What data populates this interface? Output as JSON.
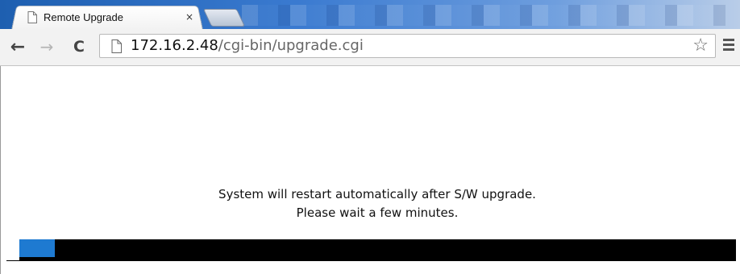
{
  "browser": {
    "tab": {
      "title": "Remote Upgrade",
      "close_label": "×"
    },
    "toolbar": {
      "back_icon": "back-arrow-icon",
      "forward_icon": "forward-arrow-icon",
      "reload_icon": "reload-icon",
      "url_host": "172.16.2.48",
      "url_path": "/cgi-bin/upgrade.cgi",
      "bookmark_icon": "star-icon",
      "menu_icon": "hamburger-menu-icon"
    }
  },
  "page": {
    "message_line1": "System will restart automatically after S/W upgrade.",
    "message_line2": "Please wait a few minutes.",
    "progress": {
      "fraction": 0.05,
      "fill_color": "#1e7ad1",
      "track_color": "#000000"
    }
  }
}
